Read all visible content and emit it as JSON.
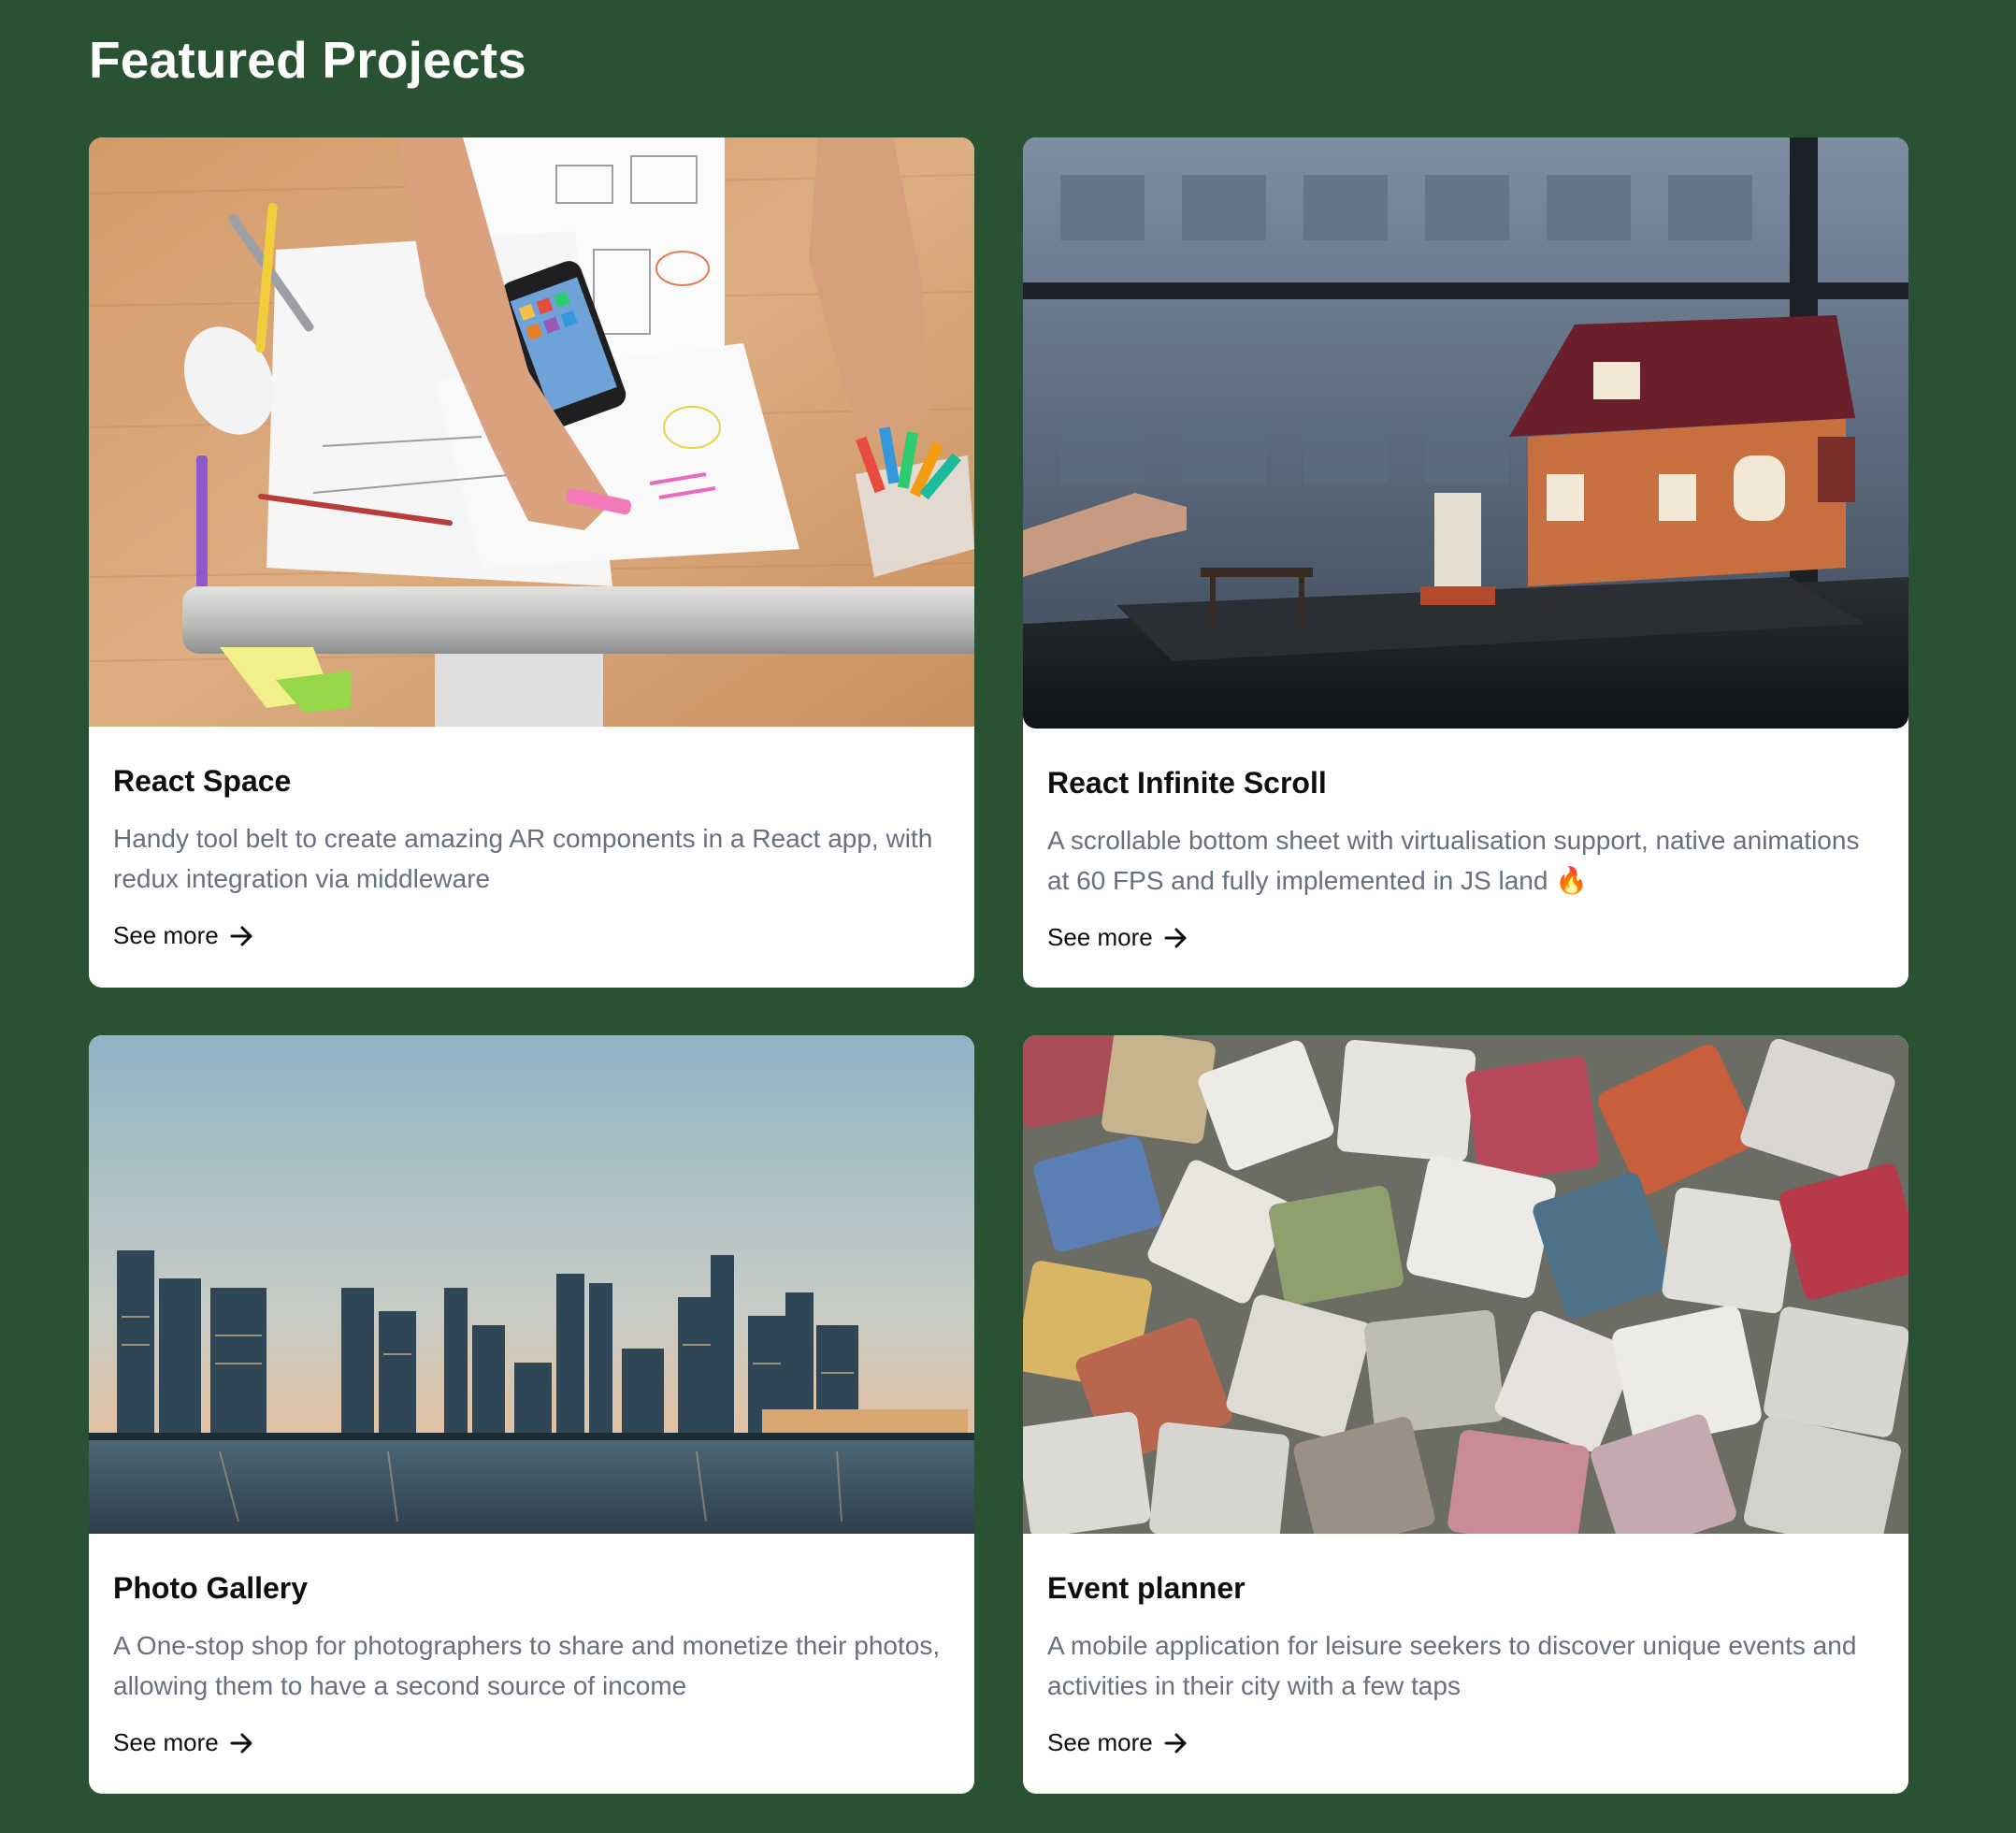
{
  "section": {
    "title": "Featured Projects"
  },
  "colors": {
    "background": "#285232",
    "card": "#ffffff",
    "title_text": "#0e0e10",
    "desc_text": "#66707f"
  },
  "projects": [
    {
      "title": "React Space",
      "description": "Handy tool belt to create amazing AR components in a React app, with redux integration via middleware",
      "link_label": "See more",
      "image": "desk-workspace-photo"
    },
    {
      "title": "React Infinite Scroll",
      "description": "A scrollable bottom sheet with virtualisation support, native animations at 60 FPS and fully implemented in JS land 🔥",
      "link_label": "See more",
      "image": "toy-house-photo"
    },
    {
      "title": "Photo Gallery",
      "description": "A One-stop shop for photographers to share and monetize their photos, allowing them to have a second source of income",
      "link_label": "See more",
      "image": "city-skyline-photo"
    },
    {
      "title": "Event planner",
      "description": "A mobile application for leisure seekers to discover unique events and activities in their city with a few taps",
      "link_label": "See more",
      "image": "colored-stones-photo"
    }
  ]
}
